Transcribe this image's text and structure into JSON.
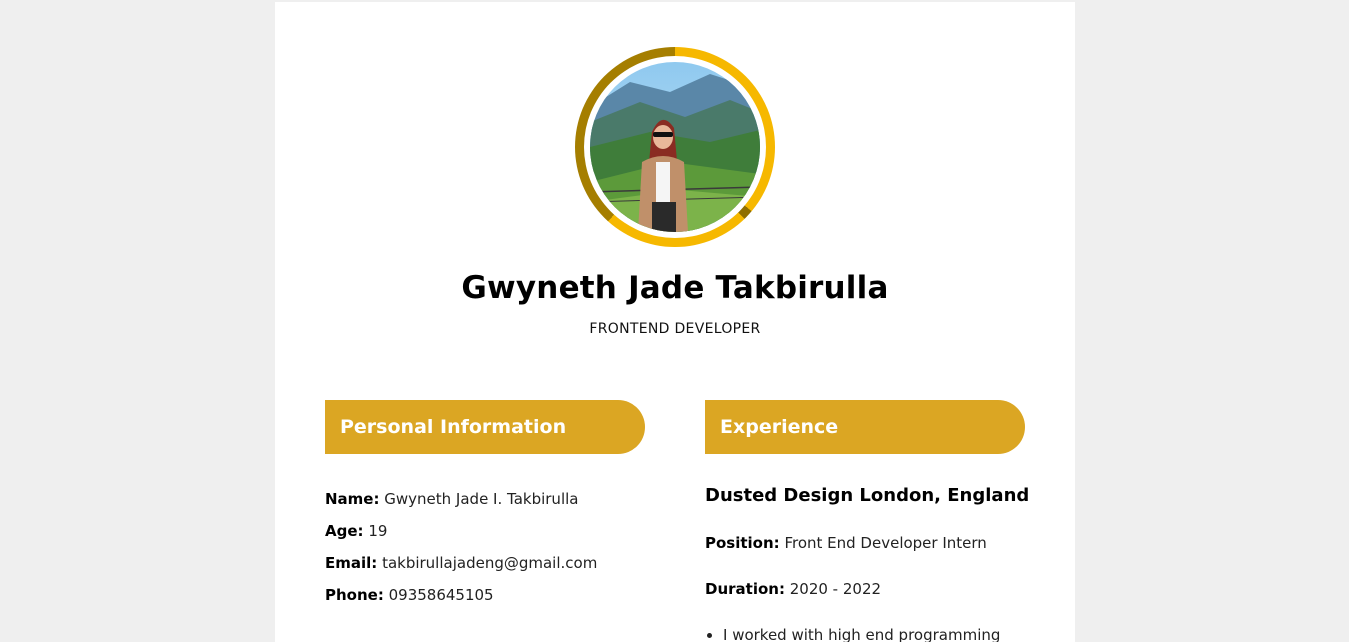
{
  "profile": {
    "name": "Gwyneth Jade Takbirulla",
    "role": "FRONTEND DEVELOPER"
  },
  "personal": {
    "title": "Personal Information",
    "rows": [
      {
        "label": "Name:",
        "value": "Gwyneth Jade I. Takbirulla"
      },
      {
        "label": "Age:",
        "value": "19"
      },
      {
        "label": "Email:",
        "value": "takbirullajadeng@gmail.com"
      },
      {
        "label": "Phone:",
        "value": "09358645105"
      }
    ]
  },
  "experience": {
    "title": "Experience",
    "company": "Dusted Design London, England",
    "position_label": "Position:",
    "position_value": "Front End Developer Intern",
    "duration_label": "Duration:",
    "duration_value": "2020 - 2022",
    "bullets": [
      "I worked with high end programming"
    ]
  },
  "colors": {
    "accent": "#dba623",
    "ring": "#f6b800",
    "background": "#efefef"
  }
}
